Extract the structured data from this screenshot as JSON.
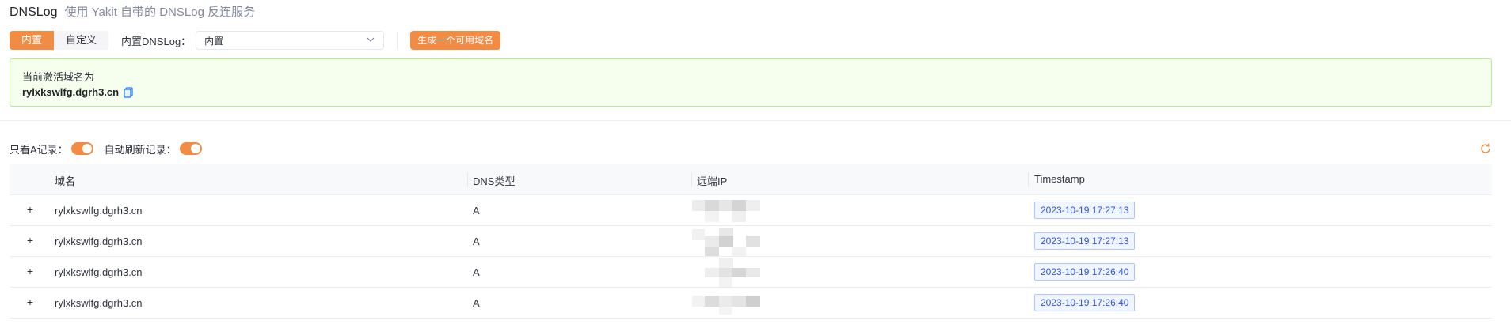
{
  "header": {
    "title": "DNSLog",
    "subtitle": "使用 Yakit 自带的 DNSLog 反连服务"
  },
  "toolbar": {
    "segment": [
      "内置",
      "自定义"
    ],
    "selected_segment": "内置",
    "dnslog_label": "内置DNSLog：",
    "dnslog_value": "内置",
    "generate_button": "生成一个可用域名"
  },
  "alert": {
    "label": "当前激活域名为",
    "domain": "rylxkswlfg.dgrh3.cn"
  },
  "filters": {
    "only_a_label": "只看A记录：",
    "only_a_enabled": true,
    "auto_refresh_label": "自动刷新记录：",
    "auto_refresh_enabled": true
  },
  "table": {
    "columns": [
      "域名",
      "DNS类型",
      "远端IP",
      "Timestamp"
    ],
    "rows": [
      {
        "domain": "rylxkswlfg.dgrh3.cn",
        "type": "A",
        "ip_redacted": true,
        "timestamp": "2023-10-19 17:27:13"
      },
      {
        "domain": "rylxkswlfg.dgrh3.cn",
        "type": "A",
        "ip_redacted": true,
        "timestamp": "2023-10-19 17:27:13"
      },
      {
        "domain": "rylxkswlfg.dgrh3.cn",
        "type": "A",
        "ip_redacted": true,
        "timestamp": "2023-10-19 17:26:40"
      },
      {
        "domain": "rylxkswlfg.dgrh3.cn",
        "type": "A",
        "ip_redacted": true,
        "timestamp": "2023-10-19 17:26:40"
      }
    ]
  },
  "icons": {
    "copy": "copy-icon",
    "refresh": "refresh-icon",
    "expand": "plus-icon",
    "dropdown": "chevron-down-icon"
  },
  "colors": {
    "accent": "#f28b44",
    "success_bg": "#f6ffed",
    "success_border": "#b7eb8f",
    "tag_blue": "#2f54eb"
  }
}
